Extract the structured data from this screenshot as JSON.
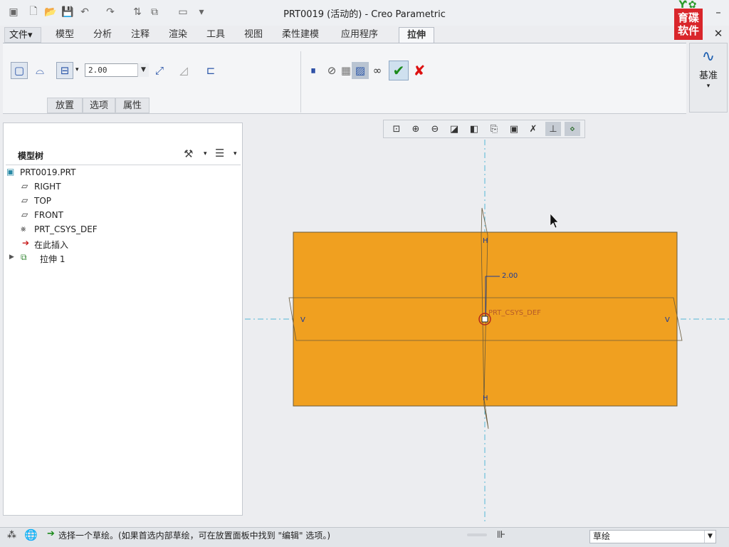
{
  "window": {
    "title": "PRT0019 (活动的) - Creo Parametric",
    "logo": {
      "line1": "育碟",
      "line2": "软件"
    }
  },
  "ribbon_tabs": [
    {
      "label": "文件▾"
    },
    {
      "label": "模型"
    },
    {
      "label": "分析"
    },
    {
      "label": "注释"
    },
    {
      "label": "渲染"
    },
    {
      "label": "工具"
    },
    {
      "label": "视图"
    },
    {
      "label": "柔性建模"
    },
    {
      "label": "应用程序"
    },
    {
      "label": "拉伸"
    }
  ],
  "ribbon": {
    "depth_value": "2.00",
    "subtabs": [
      "放置",
      "选项",
      "属性"
    ],
    "datum_label": "基准"
  },
  "model_tree": {
    "title": "模型树",
    "items": [
      {
        "label": "PRT0019.PRT",
        "icon": "part-icon"
      },
      {
        "label": "RIGHT",
        "icon": "datum-plane-icon"
      },
      {
        "label": "TOP",
        "icon": "datum-plane-icon"
      },
      {
        "label": "FRONT",
        "icon": "datum-plane-icon"
      },
      {
        "label": "PRT_CSYS_DEF",
        "icon": "csys-icon"
      },
      {
        "label": "在此插入",
        "icon": "insert-arrow-icon"
      },
      {
        "label": "拉伸 1",
        "icon": "extrude-icon"
      }
    ]
  },
  "graphics": {
    "dimension": "2.00",
    "csys_label": "PRT_CSYS_DEF",
    "markers": {
      "h": "H",
      "v": "V"
    },
    "fill_color": "#f0a020"
  },
  "status": {
    "message": "选择一个草绘。(如果首选内部草绘，可在放置面板中找到 \"编辑\" 选项。)",
    "filter_value": "草绘"
  }
}
